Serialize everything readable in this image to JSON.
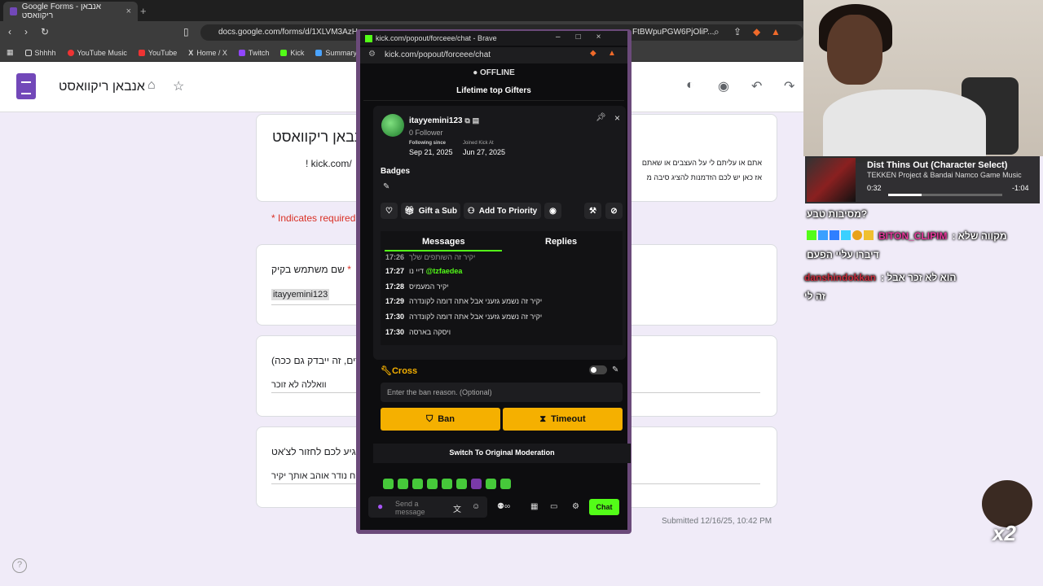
{
  "browser": {
    "tab_title": "Google Forms - אנבאן ריקוואסט",
    "url": "docs.google.com/forms/d/1XLVM3AzHn",
    "url_tail": "FtBWpuPGW6PjOliP...",
    "bookmarks": [
      "Shhhh",
      "YouTube Music",
      "YouTube",
      "Home / X",
      "Twitch",
      "Kick",
      "Summary - Pa"
    ]
  },
  "forms": {
    "title": "אנבאן ריקוואסט",
    "heading_partial": "אנבאן ריקוואסט",
    "desc_link": "! kick.com/",
    "desc_line1": "אתם או עליתם לי על העצבים או שאתם",
    "desc_line2": "אז כאן יש לכם הזדמנות להציג סיבה מ",
    "required_note": "* Indicates required",
    "q1_label": "שם משתמש בקיק",
    "q1_answer": "itayyemini123",
    "q2_label": "(צרים, זה ייבדק גם ככה)",
    "q2_answer": "וואללה לא זוכר",
    "q3_label": "מגיע לכם לחזור לצ'אט",
    "q3_answer": "ח נודר אוהב אותך יקיר",
    "submitted": "Submitted 12/16/25, 10:42 PM"
  },
  "popup": {
    "window_title": "kick.com/popout/forceee/chat - Brave",
    "url": "kick.com/popout/forceee/chat",
    "status": "OFFLINE",
    "section": "Lifetime top Gifters",
    "user": {
      "name": "itayyemini123",
      "followers": "0 Follower",
      "following_label": "Following since",
      "following_date": "Sep 21, 2025",
      "joined_label": "Joined Kick At",
      "joined_date": "Jun 27, 2025",
      "badges_label": "Badges"
    },
    "actions": {
      "gift": "Gift a Sub",
      "priority": "Add To Priority"
    },
    "tabs": {
      "messages": "Messages",
      "replies": "Replies"
    },
    "messages": [
      {
        "time": "17:26",
        "text": "יקיר זה השותפים שלך"
      },
      {
        "time": "17:27",
        "text": "דיי נו",
        "mention": "@tzfaedea"
      },
      {
        "time": "17:28",
        "text": "יקיר המעמיס"
      },
      {
        "time": "17:29",
        "text": "יקיר זה נשמע גזעני אבל אתה דומה לקונדרה"
      },
      {
        "time": "17:30",
        "text": "יקיר זה נשמע גזעני אבל אתה דומה לקונדרה"
      },
      {
        "time": "17:30",
        "text": "ויסקה בארסה"
      }
    ],
    "cross": "Cross",
    "reason_placeholder": "Enter the ban reason. (Optional)",
    "ban": "Ban",
    "timeout": "Timeout",
    "switch_mod": "Switch To Original Moderation",
    "chat_placeholder_1": "Send a",
    "chat_placeholder_2": "message",
    "chat_button": "Chat"
  },
  "overlay": {
    "song_title": "Dist Thins Out (Character Select)",
    "song_artist": "TEKKEN Project & Bandai Namco Game Music",
    "song_current": "0:32",
    "song_remaining": "-1:04",
    "progress_fraction": 0.29,
    "line1": "?מסיבות טבע",
    "line2_user": "BITON_CLIPIM",
    "line2_text": "מקווה שלא :",
    "line3": "דיברו עליי הפעם",
    "line4_user": "danshindokkan",
    "line4_text": "הוא לא זכר אבל :",
    "line5": "זה לי",
    "multiplier": "x2"
  },
  "colors": {
    "kick_green": "#53fc18",
    "forms_purple": "#7248b9",
    "ban_yellow": "#f5b000"
  }
}
